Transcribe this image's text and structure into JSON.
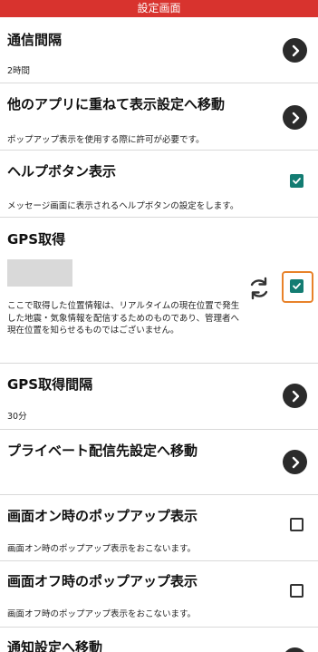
{
  "header": {
    "title": "設定画面"
  },
  "rows": {
    "interval": {
      "title": "通信間隔",
      "value": "2時間"
    },
    "overlay": {
      "title": "他のアプリに重ねて表示設定へ移動",
      "desc": "ポップアップ表示を使用する際に許可が必要です。"
    },
    "help_button": {
      "title": "ヘルプボタン表示",
      "desc": "メッセージ画面に表示されるヘルプボタンの設定をします。",
      "checked": true
    },
    "gps": {
      "title": "GPS取得",
      "desc": "ここで取得した位置情報は、リアルタイムの現在位置で発生した地震・気象情報を配信するためのものであり、管理者へ現在位置を知らせるものではございません。",
      "checked": true
    },
    "gps_interval": {
      "title": "GPS取得間隔",
      "value": "30分"
    },
    "private_delivery": {
      "title": "プライベート配信先設定へ移動"
    },
    "screen_on_popup": {
      "title": "画面オン時のポップアップ表示",
      "desc": "画面オン時のポップアップ表示をおこないます。",
      "checked": false
    },
    "screen_off_popup": {
      "title": "画面オフ時のポップアップ表示",
      "desc": "画面オフ時のポップアップ表示をおこないます。",
      "checked": false
    },
    "notification": {
      "title": "通知設定へ移動"
    }
  },
  "icons": {
    "nav": "chevron-right-icon",
    "check": "check-icon",
    "sync": "sync-icon"
  },
  "colors": {
    "header_bg": "#d8332e",
    "checkbox_checked": "#137c72",
    "focus_ring": "#e8822a",
    "nav_button": "#2b2b2b"
  }
}
